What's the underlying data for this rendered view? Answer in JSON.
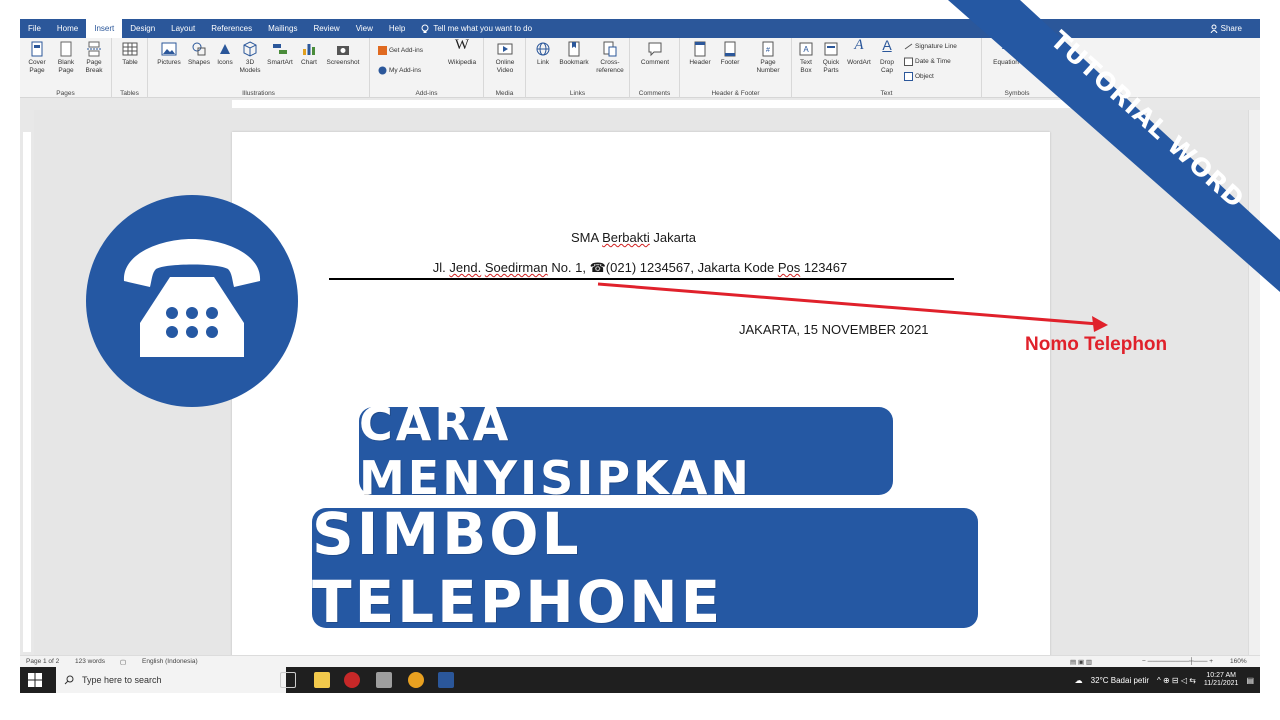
{
  "ribbon_tabs": [
    {
      "label": "File"
    },
    {
      "label": "Home"
    },
    {
      "label": "Insert",
      "active": true
    },
    {
      "label": "Design"
    },
    {
      "label": "Layout"
    },
    {
      "label": "References"
    },
    {
      "label": "Mailings"
    },
    {
      "label": "Review"
    },
    {
      "label": "View"
    },
    {
      "label": "Help"
    }
  ],
  "tell_me": "Tell me what you want to do",
  "share_label": "Share",
  "ribbon": {
    "pages": {
      "cover": "Cover Page",
      "blank": "Blank Page",
      "break": "Page Break",
      "group": "Pages"
    },
    "tables": {
      "table": "Table",
      "group": "Tables"
    },
    "illustrations": {
      "pictures": "Pictures",
      "shapes": "Shapes",
      "icons": "Icons",
      "models": "3D Models",
      "smartart": "SmartArt",
      "chart": "Chart",
      "screenshot": "Screenshot",
      "group": "Illustrations"
    },
    "addins": {
      "get": "Get Add-ins",
      "my": "My Add-ins",
      "wikipedia": "Wikipedia",
      "group": "Add-ins"
    },
    "media": {
      "video": "Online Video",
      "group": "Media"
    },
    "links": {
      "link": "Link",
      "bookmark": "Bookmark",
      "cross": "Cross-reference",
      "group": "Links"
    },
    "comments": {
      "comment": "Comment",
      "group": "Comments"
    },
    "header_footer": {
      "header": "Header",
      "footer": "Footer",
      "page_number": "Page Number",
      "group": "Header & Footer"
    },
    "text": {
      "textbox": "Text Box",
      "quickparts": "Quick Parts",
      "wordart": "WordArt",
      "dropcap": "Drop Cap",
      "signature": "Signature Line",
      "datetime": "Date & Time",
      "object": "Object",
      "group": "Text"
    },
    "symbols": {
      "equation": "Equation",
      "group": "Symbols"
    }
  },
  "document": {
    "school_prefix": "SMA ",
    "school_word": "Berbakti",
    "school_suffix": " Jakarta",
    "address_a": "Jl. ",
    "address_b": "Jend.",
    "address_c": " ",
    "address_d": "Soedirman",
    "address_e": " No. 1, ☎(021) 1234567, Jakarta Kode ",
    "address_f": "Pos",
    "address_g": " 123467",
    "date_line": "JAKARTA, 15 NOVEMBER 2021"
  },
  "overlay": {
    "callout": "Nomo Telephon",
    "title_line1": "CARA MENYISIPKAN",
    "title_line2": "SIMBOL TELEPHONE",
    "ribbon_banner": "TUTORIAL WORD",
    "accent": "#2558a3",
    "arrow_color": "#e0212b"
  },
  "status_bar": {
    "page": "Page 1 of 2",
    "words": "123 words",
    "language": "English (Indonesia)",
    "zoom": "160%"
  },
  "taskbar": {
    "search_placeholder": "Type here to search",
    "weather": "32°C  Badai petir",
    "time": "10:27 AM",
    "date": "11/21/2021"
  }
}
